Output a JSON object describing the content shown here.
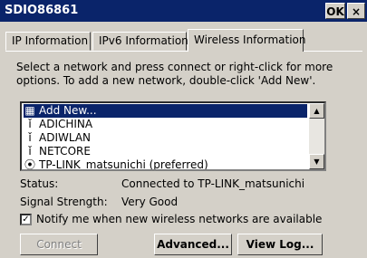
{
  "window": {
    "title": "SDIO86861",
    "ok_label": "OK",
    "close_label": "×"
  },
  "tabs": [
    {
      "label": "IP Information"
    },
    {
      "label": "IPv6 Information"
    },
    {
      "label": "Wireless Information"
    }
  ],
  "description": "Select a network and press connect or right-click for more options.  To add a new network, double-click 'Add New'.",
  "networks": [
    {
      "label": "Add New...",
      "icon": "add-network-icon"
    },
    {
      "label": "ADICHINA",
      "icon": "antenna-icon"
    },
    {
      "label": "ADIWLAN",
      "icon": "antenna-icon"
    },
    {
      "label": "NETCORE",
      "icon": "antenna-icon"
    },
    {
      "label": "TP-LINK_matsunichi (preferred)",
      "icon": "connected-icon"
    }
  ],
  "status": {
    "label": "Status:",
    "value": "Connected to TP-LINK_matsunichi"
  },
  "signal": {
    "label": "Signal Strength:",
    "value": "Very Good"
  },
  "notify": {
    "label": "Notify me when new wireless networks are available",
    "checked": true
  },
  "buttons": {
    "connect": "Connect",
    "advanced": "Advanced...",
    "view_log": "View Log..."
  }
}
